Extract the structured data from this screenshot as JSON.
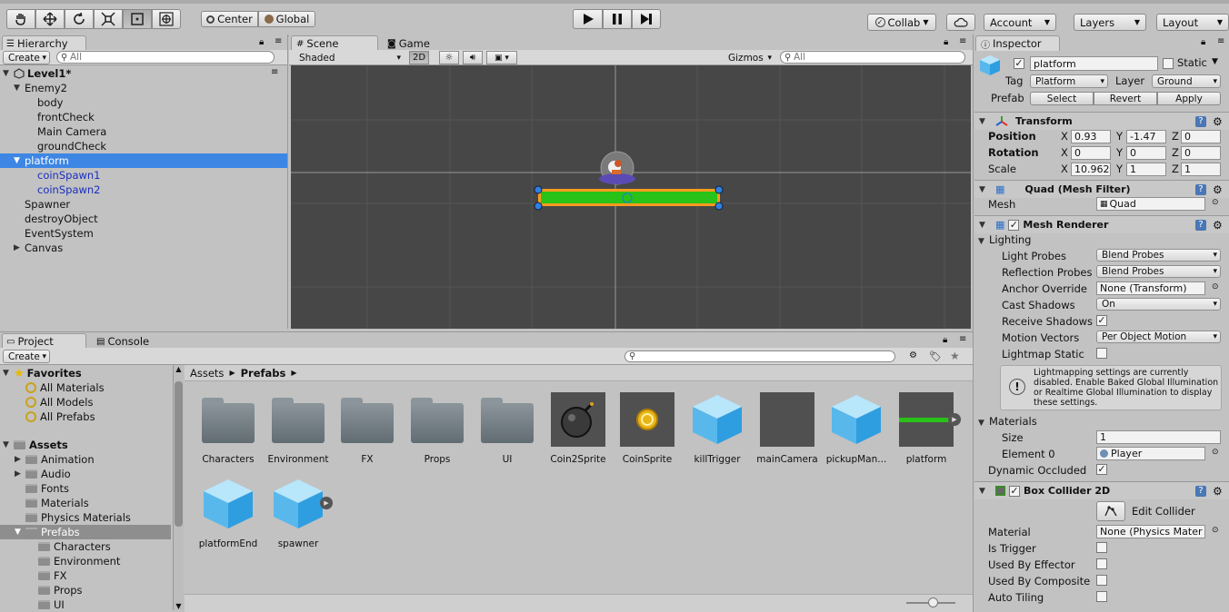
{
  "toolbar": {
    "tools": [
      "hand-tool-icon",
      "move-tool-icon",
      "rotate-tool-icon",
      "scale-tool-icon",
      "rect-tool-icon",
      "transform-tool-icon"
    ],
    "center_label": "Center",
    "global_label": "Global",
    "collab_label": "Collab",
    "account_label": "Account",
    "layers_label": "Layers",
    "layout_label": "Layout"
  },
  "hierarchy": {
    "tab_label": "Hierarchy",
    "create_label": "Create",
    "search_placeholder": "All",
    "scene_name": "Level1*",
    "items": [
      {
        "label": "Enemy2"
      },
      {
        "label": "body"
      },
      {
        "label": "frontCheck"
      },
      {
        "label": "Main Camera"
      },
      {
        "label": "groundCheck"
      },
      {
        "label": "platform"
      },
      {
        "label": "coinSpawn1"
      },
      {
        "label": "coinSpawn2"
      },
      {
        "label": "Spawner"
      },
      {
        "label": "destroyObject"
      },
      {
        "label": "EventSystem"
      },
      {
        "label": "Canvas"
      }
    ]
  },
  "scene": {
    "scene_tab": "Scene",
    "game_tab": "Game",
    "shaded_label": "Shaded",
    "mode_2d": "2D",
    "gizmos_label": "Gizmos",
    "search_placeholder": "All"
  },
  "project": {
    "project_tab": "Project",
    "console_tab": "Console",
    "create_label": "Create",
    "favorites_label": "Favorites",
    "favorites": [
      "All Materials",
      "All Models",
      "All Prefabs"
    ],
    "assets_label": "Assets",
    "folders": [
      "Animation",
      "Audio",
      "Fonts",
      "Materials",
      "Physics Materials",
      "Prefabs"
    ],
    "subfolders": [
      "Characters",
      "Environment",
      "FX",
      "Props",
      "UI"
    ],
    "breadcrumb_root": "Assets",
    "breadcrumb_current": "Prefabs",
    "assets": [
      "Characters",
      "Environment",
      "FX",
      "Props",
      "UI",
      "Coin2Sprite",
      "CoinSprite",
      "killTrigger",
      "mainCamera",
      "pickupMan...",
      "platform",
      "platformEnd",
      "spawner"
    ]
  },
  "inspector": {
    "tab_label": "Inspector",
    "object_name": "platform",
    "static_label": "Static",
    "tag_label": "Tag",
    "tag_value": "Platform",
    "layer_label": "Layer",
    "layer_value": "Ground",
    "prefab_label": "Prefab",
    "select_label": "Select",
    "revert_label": "Revert",
    "apply_label": "Apply",
    "transform": {
      "title": "Transform",
      "position_label": "Position",
      "rotation_label": "Rotation",
      "scale_label": "Scale",
      "x": "X",
      "y": "Y",
      "z": "Z",
      "position": [
        "0.93",
        "-1.47",
        "0"
      ],
      "rotation": [
        "0",
        "0",
        "0"
      ],
      "scale": [
        "10.962",
        "1",
        "1"
      ]
    },
    "mesh_filter": {
      "title": "Quad (Mesh Filter)",
      "mesh_label": "Mesh",
      "mesh_value": "Quad"
    },
    "mesh_renderer": {
      "title": "Mesh Renderer",
      "lighting_label": "Lighting",
      "light_probes_label": "Light Probes",
      "light_probes_value": "Blend Probes",
      "reflection_probes_label": "Reflection Probes",
      "reflection_probes_value": "Blend Probes",
      "anchor_override_label": "Anchor Override",
      "anchor_override_value": "None (Transform)",
      "cast_shadows_label": "Cast Shadows",
      "cast_shadows_value": "On",
      "receive_shadows_label": "Receive Shadows",
      "motion_vectors_label": "Motion Vectors",
      "motion_vectors_value": "Per Object Motion",
      "lightmap_static_label": "Lightmap Static",
      "info_text": "Lightmapping settings are currently disabled. Enable Baked Global Illumination or Realtime Global Illumination to display these settings.",
      "materials_label": "Materials",
      "size_label": "Size",
      "size_value": "1",
      "element0_label": "Element 0",
      "element0_value": "Player",
      "dynamic_occluded_label": "Dynamic Occluded"
    },
    "box_collider": {
      "title": "Box Collider 2D",
      "edit_collider_label": "Edit Collider",
      "material_label": "Material",
      "material_value": "None (Physics Mater",
      "is_trigger_label": "Is Trigger",
      "used_by_effector_label": "Used By Effector",
      "used_by_composite_label": "Used By Composite",
      "auto_tiling_label": "Auto Tiling"
    }
  }
}
